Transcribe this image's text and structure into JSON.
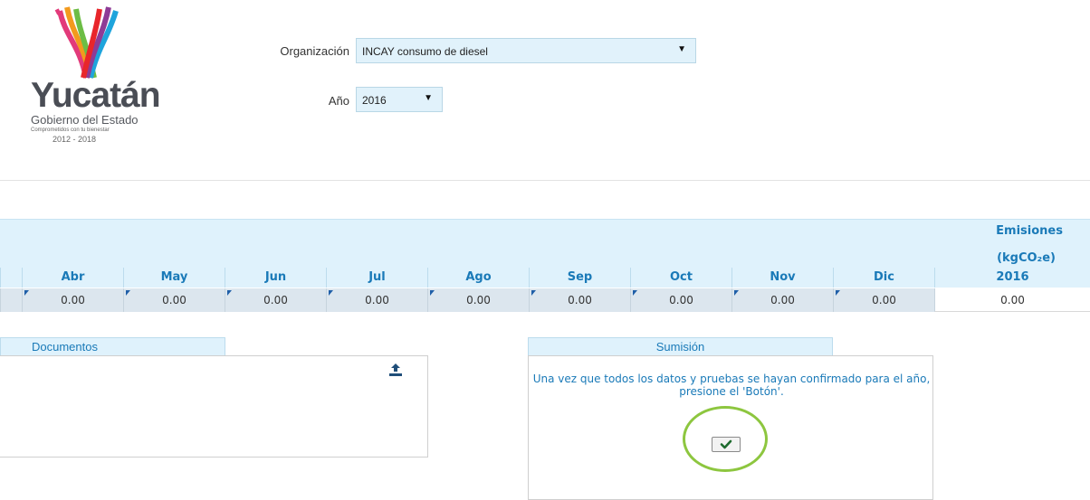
{
  "logo": {
    "name": "Yucatán",
    "subtitle": "Gobierno del Estado",
    "tagline": "Comprometidos con tu bienestar",
    "years": "2012 - 2018"
  },
  "filters": {
    "organization_label": "Organización",
    "organization_value": "INCAY consumo de diesel",
    "year_label": "Año",
    "year_value": "2016"
  },
  "table": {
    "emissions_header": "Emisiones",
    "emissions_unit": "(kgCO₂e)",
    "months": [
      "Abr",
      "May",
      "Jun",
      "Jul",
      "Ago",
      "Sep",
      "Oct",
      "Nov",
      "Dic"
    ],
    "total_header": "2016",
    "values": [
      "0.00",
      "0.00",
      "0.00",
      "0.00",
      "0.00",
      "0.00",
      "0.00",
      "0.00",
      "0.00"
    ],
    "total_value": "0.00"
  },
  "documents": {
    "title": "Documentos",
    "upload_icon": "upload-icon"
  },
  "submission": {
    "title": "Sumisión",
    "message": "Una vez que todos los datos y pruebas se hayan confirmado para el año, presione el 'Botón'.",
    "button_icon": "check-icon"
  },
  "colors": {
    "header_bg": "#dff2fc",
    "header_text": "#1a7ab8",
    "row_bg": "#dce6ee",
    "highlight_circle": "#8dc63f"
  }
}
